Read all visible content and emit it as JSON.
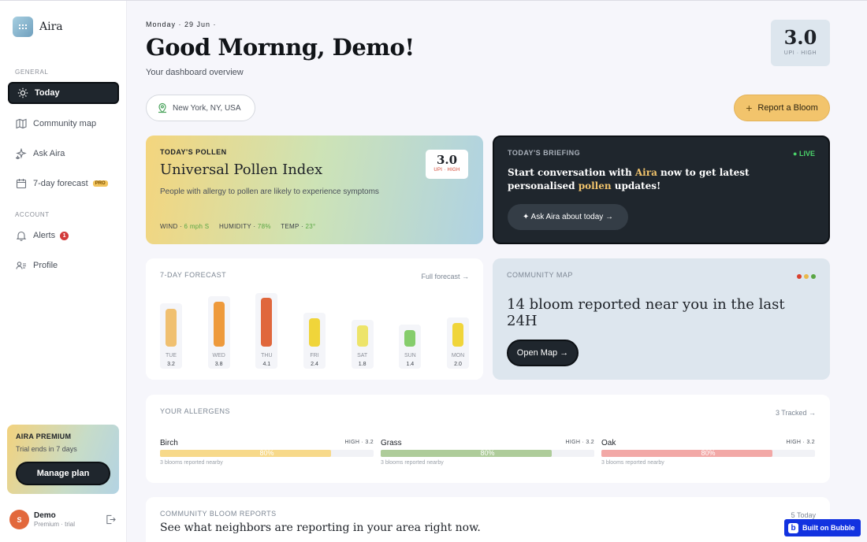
{
  "brand": {
    "name": "Aira"
  },
  "sidebar": {
    "general_label": "GENERAL",
    "account_label": "ACCOUNT",
    "items": [
      {
        "label": "Today",
        "icon": "sun-icon"
      },
      {
        "label": "Community map",
        "icon": "map-icon"
      },
      {
        "label": "Ask Aira",
        "icon": "sparkle-icon"
      },
      {
        "label": "7-day forecast",
        "icon": "calendar-icon",
        "badge": "PRO"
      },
      {
        "label": "Alerts",
        "icon": "bell-icon",
        "badge": "1"
      },
      {
        "label": "Profile",
        "icon": "profile-icon"
      }
    ]
  },
  "premium": {
    "title": "AIRA PREMIUM",
    "subtitle": "Trial ends in 7 days",
    "button": "Manage plan"
  },
  "user": {
    "initial": "S",
    "name": "Demo",
    "plan": "Premium · trial"
  },
  "header": {
    "date": "Monday · 29 Jun ·",
    "greeting": "Good Mornng, Demo!",
    "subtitle": "Your dashboard overview",
    "upi_value": "3.0",
    "upi_label": "UPI · HIGH"
  },
  "location": {
    "text": "New York, NY, USA"
  },
  "report_button": {
    "label": "Report a Bloom"
  },
  "pollen": {
    "label": "TODAY'S POLLEN",
    "title": "Universal Pollen Index",
    "description": "People with allergy to pollen are likely to experience symptoms",
    "upi_value": "3.0",
    "upi_label": "UPI · HIGH",
    "wind_label": "WIND · ",
    "wind_value": "6 mph S",
    "humidity_label": "HUMIDITY · ",
    "humidity_value": "78%",
    "temp_label": "TEMP · ",
    "temp_value": "23°"
  },
  "briefing": {
    "label": "TODAY'S BRIEFING",
    "live": "● LIVE",
    "text_1": "Start conversation with ",
    "highlight_1": "Aira",
    "text_2": " now to get latest personalised ",
    "highlight_2": "pollen",
    "text_3": " updates!",
    "button": "✦ Ask Aira about today →"
  },
  "forecast": {
    "label": "7-DAY FORECAST",
    "link": "Full forecast →"
  },
  "chart_data": {
    "type": "bar",
    "categories": [
      "TUE",
      "WED",
      "THU",
      "FRI",
      "SAT",
      "SUN",
      "MON"
    ],
    "values": [
      3.2,
      3.8,
      4.1,
      2.4,
      1.8,
      1.4,
      2.0
    ],
    "value_labels": [
      "3.2",
      "3.8",
      "4.1",
      "2.4",
      "1.8",
      "1.4",
      "2.0"
    ],
    "colors": [
      "#f0c070",
      "#ee9a3c",
      "#e0673c",
      "#f0d53a",
      "#ede46a",
      "#86cd6c",
      "#f0d53a"
    ],
    "ylim": [
      0,
      4.1
    ]
  },
  "community_map": {
    "label": "COMMUNITY MAP",
    "text": "14 bloom reported near you in the last 24H",
    "button": "Open Map →",
    "dot_colors": [
      "#d9412f",
      "#e9b84a",
      "#5aa644"
    ]
  },
  "allergens": {
    "label": "YOUR ALLERGENS",
    "link": "3 Tracked →",
    "items": [
      {
        "name": "Birch",
        "level": "HIGH · 3.2",
        "percent": 80,
        "percent_label": "80%",
        "note": "3 blooms reported nearby",
        "color": "#f7d98a"
      },
      {
        "name": "Grass",
        "level": "HIGH · 3.2",
        "percent": 80,
        "percent_label": "80%",
        "note": "3 blooms reported nearby",
        "color": "#aecc9a"
      },
      {
        "name": "Oak",
        "level": "HIGH · 3.2",
        "percent": 80,
        "percent_label": "80%",
        "note": "3 blooms reported nearby",
        "color": "#f2a8a6"
      }
    ]
  },
  "reports": {
    "label": "COMMUNITY BLOOM REPORTS",
    "count": "5 Today",
    "title": "See what neighbors are reporting in your area right now."
  },
  "bubble_badge": {
    "label": "Built on Bubble"
  }
}
